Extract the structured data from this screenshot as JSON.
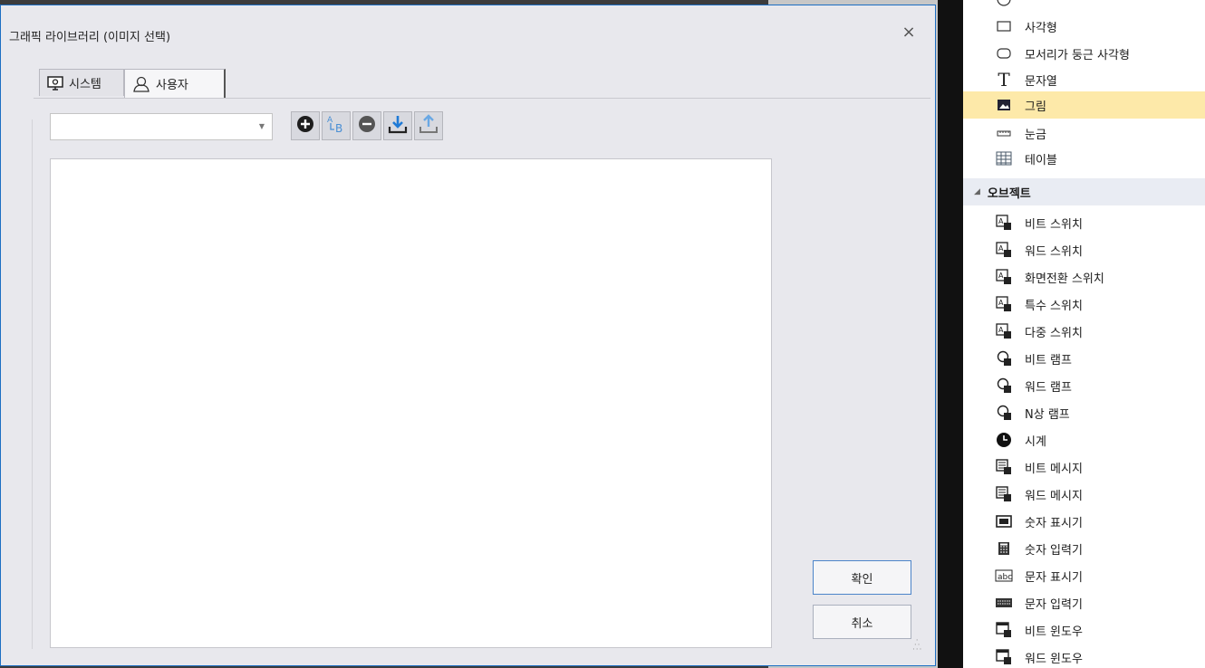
{
  "dialog": {
    "title": "그래픽 라이브러리 (이미지 선택)",
    "close_glyph": "×",
    "tabs": [
      {
        "label": "시스템",
        "icon": "monitor-gear-icon"
      },
      {
        "label": "사용자",
        "icon": "user-icon"
      }
    ],
    "active_tab": "사용자",
    "combo_value": "",
    "toolbar": [
      "add-icon",
      "rename-icon",
      "remove-icon",
      "import-icon",
      "export-icon"
    ],
    "ok_label": "확인",
    "cancel_label": "취소"
  },
  "palette": {
    "items": [
      {
        "label": "사각형",
        "icon": "rectangle-icon"
      },
      {
        "label": "모서리가 둥근 사각형",
        "icon": "rounded-rectangle-icon"
      },
      {
        "label": "문자열",
        "icon": "text-icon"
      },
      {
        "label": "그림",
        "icon": "picture-icon",
        "selected": true
      },
      {
        "label": "눈금",
        "icon": "scale-icon"
      },
      {
        "label": "테이블",
        "icon": "table-icon"
      }
    ],
    "section": {
      "label": "오브젝트"
    },
    "objects": [
      {
        "label": "비트 스위치",
        "icon": "bit-switch-icon"
      },
      {
        "label": "워드 스위치",
        "icon": "word-switch-icon"
      },
      {
        "label": "화면전환 스위치",
        "icon": "screen-switch-icon"
      },
      {
        "label": "특수 스위치",
        "icon": "special-switch-icon"
      },
      {
        "label": "다중 스위치",
        "icon": "multi-switch-icon"
      },
      {
        "label": "비트 램프",
        "icon": "bit-lamp-icon"
      },
      {
        "label": "워드 램프",
        "icon": "word-lamp-icon"
      },
      {
        "label": "N상 램프",
        "icon": "n-state-lamp-icon"
      },
      {
        "label": "시계",
        "icon": "clock-icon"
      },
      {
        "label": "비트 메시지",
        "icon": "bit-message-icon"
      },
      {
        "label": "워드 메시지",
        "icon": "word-message-icon"
      },
      {
        "label": "숫자 표시기",
        "icon": "numeric-display-icon"
      },
      {
        "label": "숫자 입력기",
        "icon": "numeric-input-icon"
      },
      {
        "label": "문자 표시기",
        "icon": "text-display-icon"
      },
      {
        "label": "문자 입력기",
        "icon": "text-input-icon"
      },
      {
        "label": "비트 윈도우",
        "icon": "bit-window-icon"
      },
      {
        "label": "워드 윈도우",
        "icon": "word-window-icon"
      }
    ]
  },
  "colors": {
    "accent": "#1c6ec3",
    "selected_row": "#fde9a9"
  }
}
